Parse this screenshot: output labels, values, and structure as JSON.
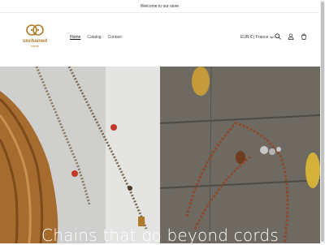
{
  "announcement": "Welcome to our store",
  "logo": {
    "line1": "unchained",
    "line2": "cords"
  },
  "nav": {
    "items": [
      "Home",
      "Catalog",
      "Contact"
    ],
    "active": "Home"
  },
  "locale": {
    "label": "EUR € | France",
    "chevron": "chevron-down-icon"
  },
  "header_icons": [
    "search-icon",
    "account-icon",
    "cart-icon"
  ],
  "hero": {
    "title": "Chains that go beyond cords"
  },
  "colors": {
    "brand": "#b07a2a",
    "text": "#333333",
    "hero_text": "#ffffff"
  }
}
